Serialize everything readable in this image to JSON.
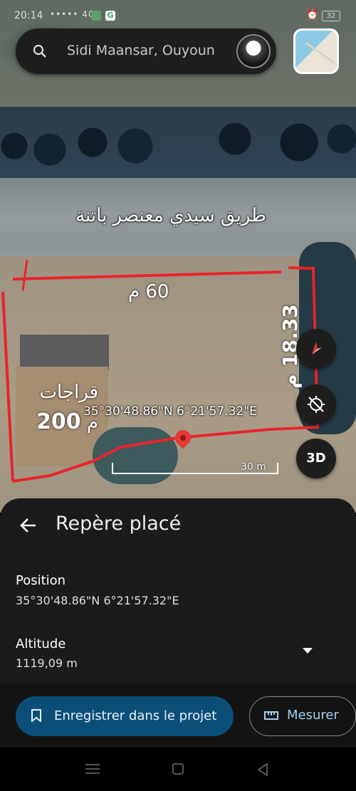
{
  "status_bar": {
    "time": "20:14",
    "signal": "••••• 4G",
    "battery": "32"
  },
  "search": {
    "query": "Sidi Maansar, Ouyoun",
    "icon": "search-icon"
  },
  "map": {
    "road_label": "طريق سيدي معنصر باتنة",
    "width_label": "60 م",
    "garages_label": "قراجات",
    "garages_value": "200",
    "garages_unit": "م",
    "side_label": "18.33 م",
    "coords_label": "35°30'48.86\"N 6°21'57.32\"E",
    "scale_label": "30 m",
    "fab_3d": "3D",
    "annotation_color": "#e8242b"
  },
  "sheet": {
    "title": "Repère placé",
    "position_label": "Position",
    "position_value": "35°30'48.86\"N 6°21'57.32\"E",
    "altitude_label": "Altitude",
    "altitude_value": "1119,09 m"
  },
  "actions": {
    "save_label": "Enregistrer dans le projet",
    "measure_label": "Mesurer",
    "save_color": "#0b4f79"
  }
}
